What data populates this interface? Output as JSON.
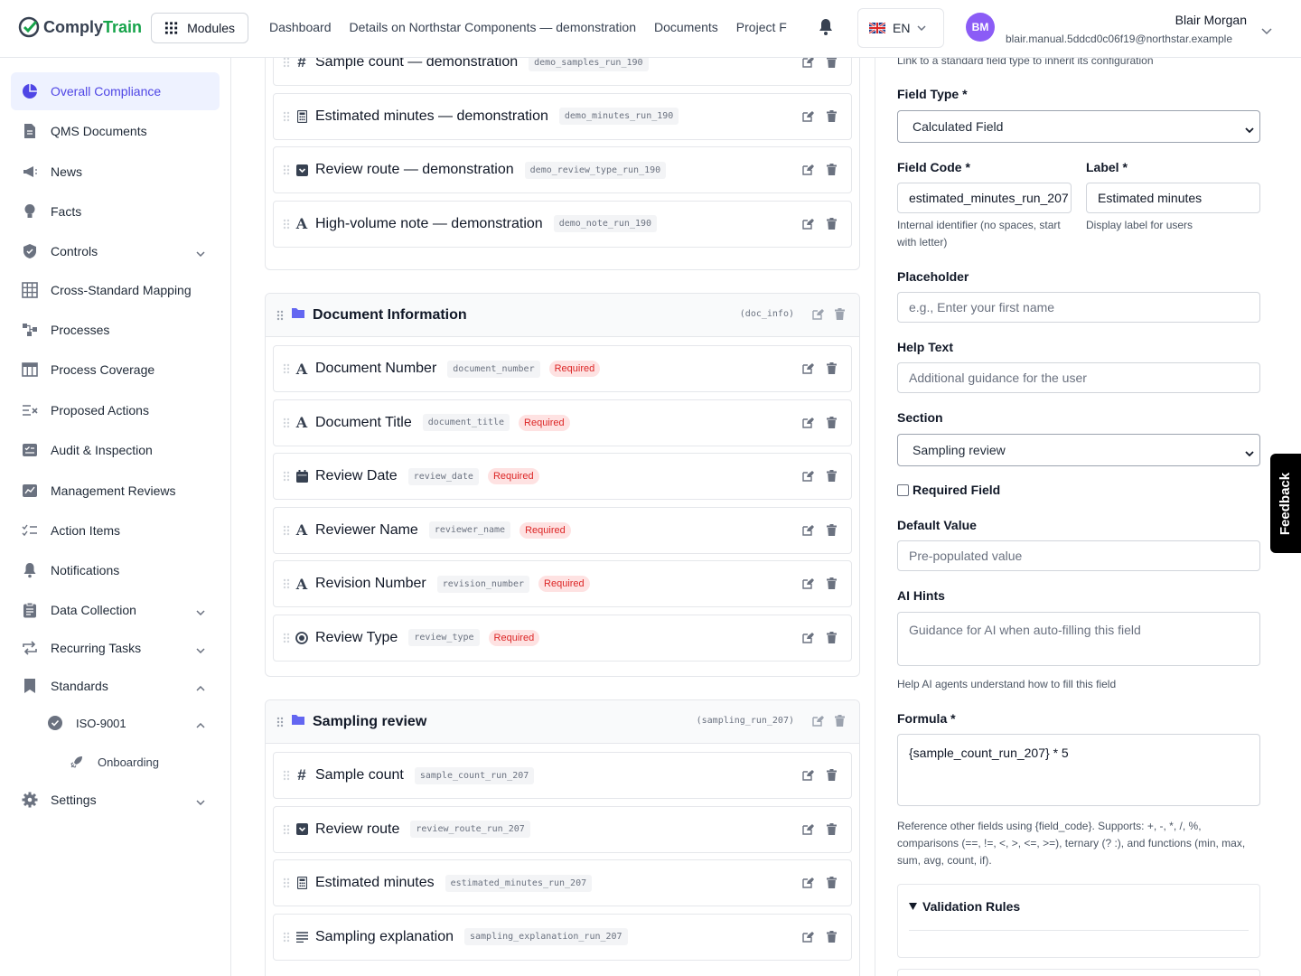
{
  "app": {
    "logo_part1": "Comply",
    "logo_part2": "Train"
  },
  "topbar": {
    "modules_label": "Modules",
    "nav": [
      "Dashboard",
      "Details on Northstar Components — demonstration",
      "Documents",
      "Project F"
    ],
    "lang": "EN",
    "user_initials": "BM",
    "user_name": "Blair Morgan",
    "user_email": "blair.manual.5ddcd0c06f19@northstar.example"
  },
  "sidebar": {
    "items": [
      {
        "label": "Overall Compliance",
        "icon": "pie-chart-icon"
      },
      {
        "label": "QMS Documents",
        "icon": "document-icon"
      },
      {
        "label": "News",
        "icon": "megaphone-icon"
      },
      {
        "label": "Facts",
        "icon": "lightbulb-icon"
      },
      {
        "label": "Controls",
        "icon": "shield-icon"
      },
      {
        "label": "Cross-Standard Mapping",
        "icon": "grid-icon"
      },
      {
        "label": "Processes",
        "icon": "process-icon"
      },
      {
        "label": "Process Coverage",
        "icon": "table-icon"
      },
      {
        "label": "Proposed Actions",
        "icon": "list-x-icon"
      },
      {
        "label": "Audit & Inspection",
        "icon": "checklist-icon"
      },
      {
        "label": "Management Reviews",
        "icon": "chart-edit-icon"
      },
      {
        "label": "Action Items",
        "icon": "list-check-icon"
      },
      {
        "label": "Notifications",
        "icon": "bell-icon"
      },
      {
        "label": "Data Collection",
        "icon": "clipboard-icon"
      },
      {
        "label": "Recurring Tasks",
        "icon": "repeat-icon"
      },
      {
        "label": "Standards",
        "icon": "bookmark-icon"
      },
      {
        "label": "ISO-9001",
        "icon": "badge-check-icon"
      },
      {
        "label": "Onboarding",
        "icon": "rocket-icon"
      },
      {
        "label": "Settings",
        "icon": "gear-icon"
      }
    ]
  },
  "main": {
    "top_fields": [
      {
        "name": "Sample count — demonstration",
        "code": "demo_samples_run_190",
        "type": "#"
      },
      {
        "name": "Estimated minutes — demonstration",
        "code": "demo_minutes_run_190",
        "type": "calc"
      },
      {
        "name": "Review route — demonstration",
        "code": "demo_review_type_run_190",
        "type": "select"
      },
      {
        "name": "High-volume note — demonstration",
        "code": "demo_note_run_190",
        "type": "A"
      }
    ],
    "doc_section": {
      "title": "Document Information",
      "code": "(doc_info)",
      "fields": [
        {
          "name": "Document Number",
          "code": "document_number",
          "required": "Required",
          "type": "A"
        },
        {
          "name": "Document Title",
          "code": "document_title",
          "required": "Required",
          "type": "A"
        },
        {
          "name": "Review Date",
          "code": "review_date",
          "required": "Required",
          "type": "cal"
        },
        {
          "name": "Reviewer Name",
          "code": "reviewer_name",
          "required": "Required",
          "type": "A"
        },
        {
          "name": "Revision Number",
          "code": "revision_number",
          "required": "Required",
          "type": "A"
        },
        {
          "name": "Review Type",
          "code": "review_type",
          "required": "Required",
          "type": "radio"
        }
      ]
    },
    "sampling_section": {
      "title": "Sampling review",
      "code": "(sampling_run_207)",
      "fields": [
        {
          "name": "Sample count",
          "code": "sample_count_run_207",
          "type": "#"
        },
        {
          "name": "Review route",
          "code": "review_route_run_207",
          "type": "select"
        },
        {
          "name": "Estimated minutes",
          "code": "estimated_minutes_run_207",
          "type": "calc"
        },
        {
          "name": "Sampling explanation",
          "code": "sampling_explanation_run_207",
          "type": "text"
        }
      ]
    }
  },
  "panel": {
    "top_help": "Link to a standard field type to inherit its configuration",
    "field_type_label": "Field Type *",
    "field_type_value": "Calculated Field",
    "field_code_label": "Field Code *",
    "field_code_value": "estimated_minutes_run_207",
    "field_code_help": "Internal identifier (no spaces, start with letter)",
    "label_label": "Label *",
    "label_value": "Estimated minutes",
    "label_help": "Display label for users",
    "placeholder_label": "Placeholder",
    "placeholder_ph": "e.g., Enter your first name",
    "help_text_label": "Help Text",
    "help_text_ph": "Additional guidance for the user",
    "section_label": "Section",
    "section_value": "Sampling review",
    "required_label": "Required Field",
    "default_label": "Default Value",
    "default_ph": "Pre-populated value",
    "ai_label": "AI Hints",
    "ai_ph": "Guidance for AI when auto-filling this field",
    "ai_help": "Help AI agents understand how to fill this field",
    "formula_label": "Formula *",
    "formula_value": "{sample_count_run_207} * 5",
    "formula_help": "Reference other fields using {field_code}. Supports: +, -, *, /, %, comparisons (==, !=, <, >, <=, >=), ternary (? :), and functions (min, max, sum, avg, count, if).",
    "validation_label": "Validation Rules"
  },
  "feedback": "Feedback"
}
